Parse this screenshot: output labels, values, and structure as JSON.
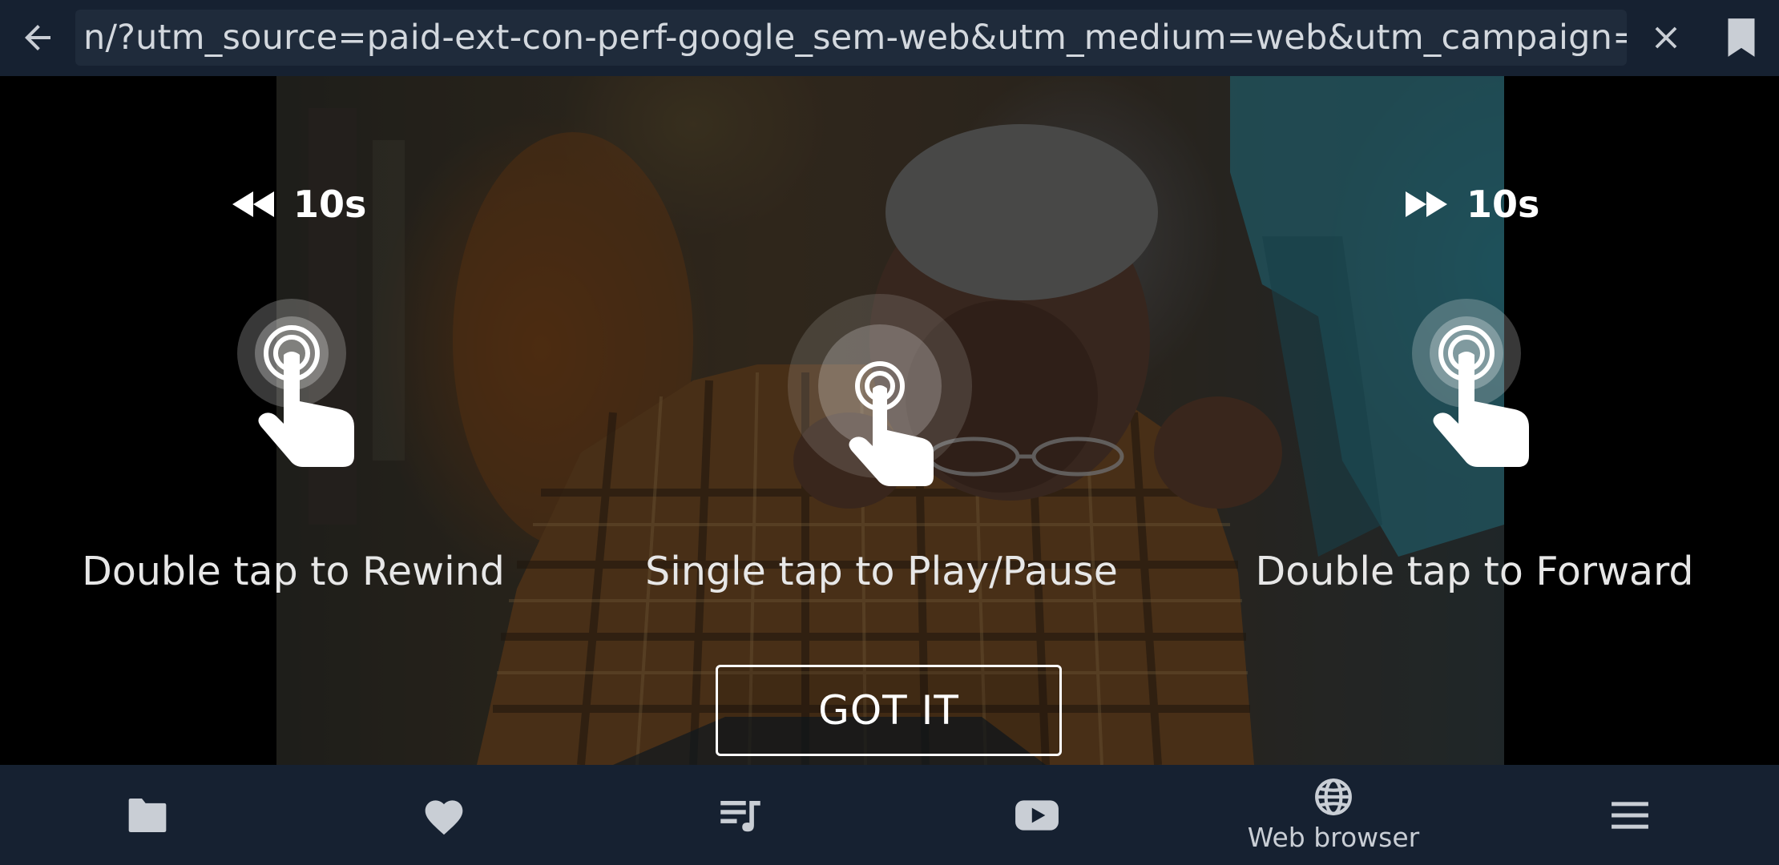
{
  "address_bar": {
    "url": "n/?utm_source=paid-ext-con-perf-google_sem-web&utm_medium=web&utm_campaign=se",
    "back_icon": "arrow-left-icon",
    "close_icon": "close-icon",
    "bookmark_icon": "bookmark-icon"
  },
  "tutorial": {
    "rewind_seconds": "10s",
    "forward_seconds": "10s",
    "rewind_label": "Double tap to Rewind",
    "play_pause_label": "Single tap to Play/Pause",
    "forward_label": "Double tap to Forward",
    "confirm_button": "GOT IT"
  },
  "bottom_nav": {
    "items": [
      {
        "icon": "folder-icon",
        "label": ""
      },
      {
        "icon": "heart-icon",
        "label": ""
      },
      {
        "icon": "playlist-icon",
        "label": ""
      },
      {
        "icon": "youtube-icon",
        "label": ""
      },
      {
        "icon": "globe-icon",
        "label": "Web browser"
      },
      {
        "icon": "menu-icon",
        "label": ""
      }
    ]
  },
  "colors": {
    "bar_background": "#162131",
    "url_field": "#1f2b3b",
    "overlay": "rgba(0,0,0,0.48)"
  }
}
